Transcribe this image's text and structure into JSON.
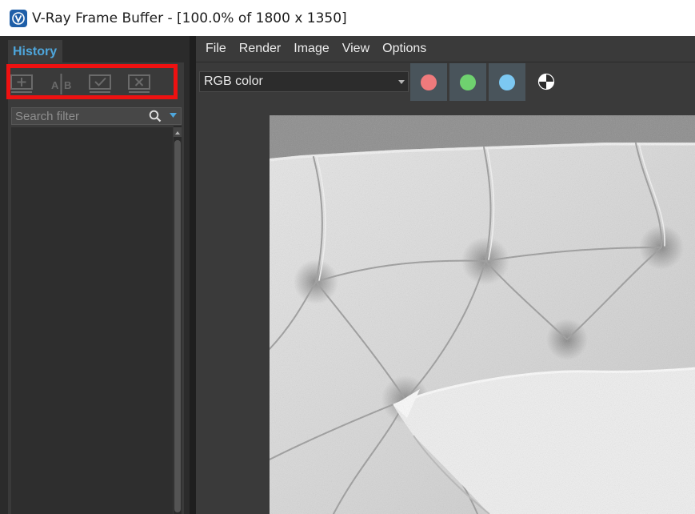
{
  "window": {
    "title": "V-Ray Frame Buffer - [100.0% of 1800 x 1350]",
    "app_icon": "vray-logo-icon"
  },
  "history_panel": {
    "tab_label": "History",
    "toolbar_icons": [
      "save-to-history-icon",
      "ab-compare-icon",
      "load-from-history-icon",
      "remove-from-history-icon"
    ],
    "search": {
      "placeholder": "Search filter",
      "value": ""
    },
    "highlight_color": "#ee1111"
  },
  "menu": {
    "items": [
      "File",
      "Render",
      "Image",
      "View",
      "Options"
    ]
  },
  "toolbar": {
    "channel_select": {
      "value": "RGB color"
    },
    "channel_buttons": [
      {
        "name": "red-channel",
        "color": "#ef7a7c"
      },
      {
        "name": "green-channel",
        "color": "#6fd16f"
      },
      {
        "name": "blue-channel",
        "color": "#7cc8f2"
      }
    ],
    "mono_icon": "monochrome-icon"
  },
  "colors": {
    "accent": "#4ea6dc",
    "panel_bg": "#2b2b2b",
    "app_bg": "#3a3a3a"
  }
}
